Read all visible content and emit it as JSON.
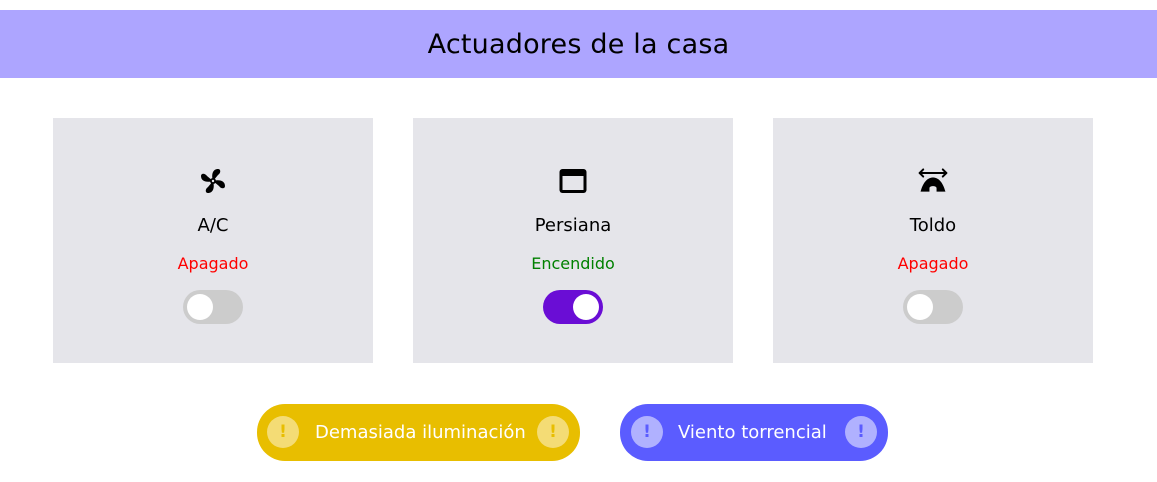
{
  "header": {
    "title": "Actuadores de la casa",
    "background": "#ada5ff"
  },
  "cards": [
    {
      "icon": "fan-icon",
      "label": "A/C",
      "status": "Apagado",
      "status_color": "#ff0000",
      "toggle_on": false
    },
    {
      "icon": "window-icon",
      "label": "Persiana",
      "status": "Encendido",
      "status_color": "#008000",
      "toggle_on": true
    },
    {
      "icon": "awning-icon",
      "label": "Toldo",
      "status": "Apagado",
      "status_color": "#ff0000",
      "toggle_on": false
    }
  ],
  "alerts": [
    {
      "text": "Demasiada iluminación",
      "icon": "exclamation-icon",
      "background": "#e8be00"
    },
    {
      "text": "Viento torrencial",
      "icon": "exclamation-icon",
      "background": "#5b5cff"
    }
  ],
  "colors": {
    "card_background": "#e5e5ea",
    "toggle_on": "#6a0dd5",
    "toggle_off": "#cccccc"
  }
}
